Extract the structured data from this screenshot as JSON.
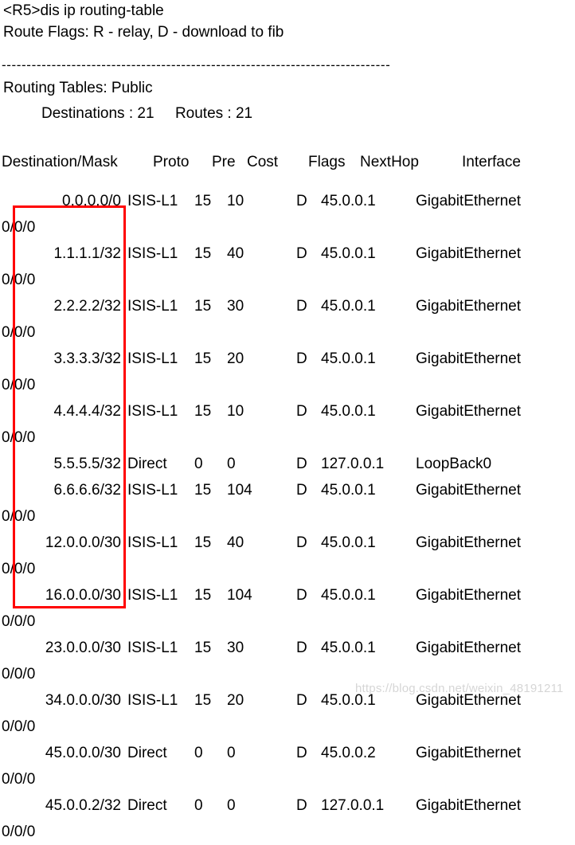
{
  "terminal": {
    "prompt_line": "<R5>dis ip routing-table",
    "route_flags_line": "Route Flags: R - relay, D - download to fib",
    "separator": "------------------------------------------------------------------------------",
    "routing_tables_line": "Routing Tables: Public",
    "destinations_label": "Destinations : 21",
    "routes_label": "Routes : 21",
    "columns": {
      "destination_mask": "Destination/Mask",
      "proto": "Proto",
      "pre": "Pre",
      "cost": "Cost",
      "flags": "Flags",
      "nexthop": "NextHop",
      "interface": "Interface"
    },
    "wrap_suffix": "0/0/0",
    "routes": [
      {
        "dest": "0.0.0.0/0",
        "proto": "ISIS-L1",
        "pre": "15",
        "cost": "10",
        "flags": "D",
        "nexthop": "45.0.0.1",
        "interface": "GigabitEthernet",
        "wrap": "0/0/0"
      },
      {
        "dest": "1.1.1.1/32",
        "proto": "ISIS-L1",
        "pre": "15",
        "cost": "40",
        "flags": "D",
        "nexthop": "45.0.0.1",
        "interface": "GigabitEthernet",
        "wrap": "0/0/0"
      },
      {
        "dest": "2.2.2.2/32",
        "proto": "ISIS-L1",
        "pre": "15",
        "cost": "30",
        "flags": "D",
        "nexthop": "45.0.0.1",
        "interface": "GigabitEthernet",
        "wrap": "0/0/0"
      },
      {
        "dest": "3.3.3.3/32",
        "proto": "ISIS-L1",
        "pre": "15",
        "cost": "20",
        "flags": "D",
        "nexthop": "45.0.0.1",
        "interface": "GigabitEthernet",
        "wrap": "0/0/0"
      },
      {
        "dest": "4.4.4.4/32",
        "proto": "ISIS-L1",
        "pre": "15",
        "cost": "10",
        "flags": "D",
        "nexthop": "45.0.0.1",
        "interface": "GigabitEthernet",
        "wrap": "0/0/0"
      },
      {
        "dest": "5.5.5.5/32",
        "proto": "Direct",
        "pre": "0",
        "cost": "0",
        "flags": "D",
        "nexthop": "127.0.0.1",
        "interface": "LoopBack0",
        "wrap": ""
      },
      {
        "dest": "6.6.6.6/32",
        "proto": "ISIS-L1",
        "pre": "15",
        "cost": "104",
        "flags": "D",
        "nexthop": "45.0.0.1",
        "interface": "GigabitEthernet",
        "wrap": "0/0/0"
      },
      {
        "dest": "12.0.0.0/30",
        "proto": "ISIS-L1",
        "pre": "15",
        "cost": "40",
        "flags": "D",
        "nexthop": "45.0.0.1",
        "interface": "GigabitEthernet",
        "wrap": "0/0/0"
      },
      {
        "dest": "16.0.0.0/30",
        "proto": "ISIS-L1",
        "pre": "15",
        "cost": "104",
        "flags": "D",
        "nexthop": "45.0.0.1",
        "interface": "GigabitEthernet",
        "wrap": "0/0/0"
      },
      {
        "dest": "23.0.0.0/30",
        "proto": "ISIS-L1",
        "pre": "15",
        "cost": "30",
        "flags": "D",
        "nexthop": "45.0.0.1",
        "interface": "GigabitEthernet",
        "wrap": "0/0/0"
      },
      {
        "dest": "34.0.0.0/30",
        "proto": "ISIS-L1",
        "pre": "15",
        "cost": "20",
        "flags": "D",
        "nexthop": "45.0.0.1",
        "interface": "GigabitEthernet",
        "wrap": "0/0/0"
      },
      {
        "dest": "45.0.0.0/30",
        "proto": "Direct",
        "pre": "0",
        "cost": "0",
        "flags": "D",
        "nexthop": "45.0.0.2",
        "interface": "GigabitEthernet",
        "wrap": "0/0/0"
      },
      {
        "dest": "45.0.0.2/32",
        "proto": "Direct",
        "pre": "0",
        "cost": "0",
        "flags": "D",
        "nexthop": "127.0.0.1",
        "interface": "GigabitEthernet",
        "wrap": "0/0/0"
      }
    ]
  },
  "annotation": {
    "highlight_color": "#ff0000",
    "highlight_label": "destination-mask-highlight"
  },
  "watermark": {
    "text": "https://blog.csdn.net/weixin_48191211",
    "color": "#d6d6d6"
  }
}
